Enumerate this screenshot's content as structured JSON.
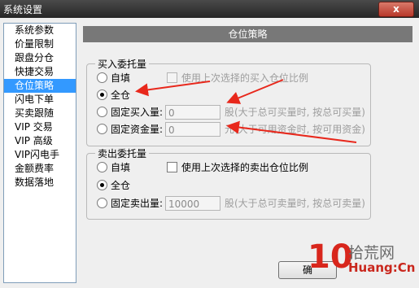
{
  "window": {
    "title": "系统设置",
    "close_glyph": "x"
  },
  "sidebar": {
    "items": [
      {
        "label": "系统参数"
      },
      {
        "label": "价量限制"
      },
      {
        "label": "跟盘分仓"
      },
      {
        "label": "快捷交易"
      },
      {
        "label": "仓位策略",
        "selected": true
      },
      {
        "label": "闪电下单"
      },
      {
        "label": "买卖跟随"
      },
      {
        "label": "VIP 交易"
      },
      {
        "label": "VIP 高级"
      },
      {
        "label": "VIP闪电手"
      },
      {
        "label": "金额费率"
      },
      {
        "label": "数据落地"
      }
    ]
  },
  "panel": {
    "header": "仓位策略"
  },
  "buy_group": {
    "label": "买入委托量",
    "option_manual": "自填",
    "use_last_checkbox": "使用上次选择的买入仓位比例",
    "option_all": "全仓",
    "option_fixed_qty": "固定买入量:",
    "fixed_qty_value": "0",
    "fixed_qty_note": "股(大于总可买量时, 按总可买量)",
    "option_fixed_amount": "固定资金量:",
    "fixed_amount_value": "0",
    "fixed_amount_note": "元(大于可用资金时, 按可用资金)",
    "selected": "全仓"
  },
  "sell_group": {
    "label": "卖出委托量",
    "option_manual": "自填",
    "use_last_checkbox": "使用上次选择的卖出仓位比例",
    "option_all": "全仓",
    "option_fixed_qty": "固定卖出量:",
    "fixed_qty_value": "10000",
    "fixed_qty_note": "股(大于总可卖量时, 按总可卖量)",
    "selected": "全仓"
  },
  "footer": {
    "confirm_label": "确"
  },
  "watermark": {
    "logo_number": "10",
    "site": "拾荒网",
    "domain": "Huang:Cn"
  },
  "colors": {
    "accent_selected": "#3399ff",
    "header_bg": "#787878",
    "annotation_arrow": "#e8281c"
  }
}
